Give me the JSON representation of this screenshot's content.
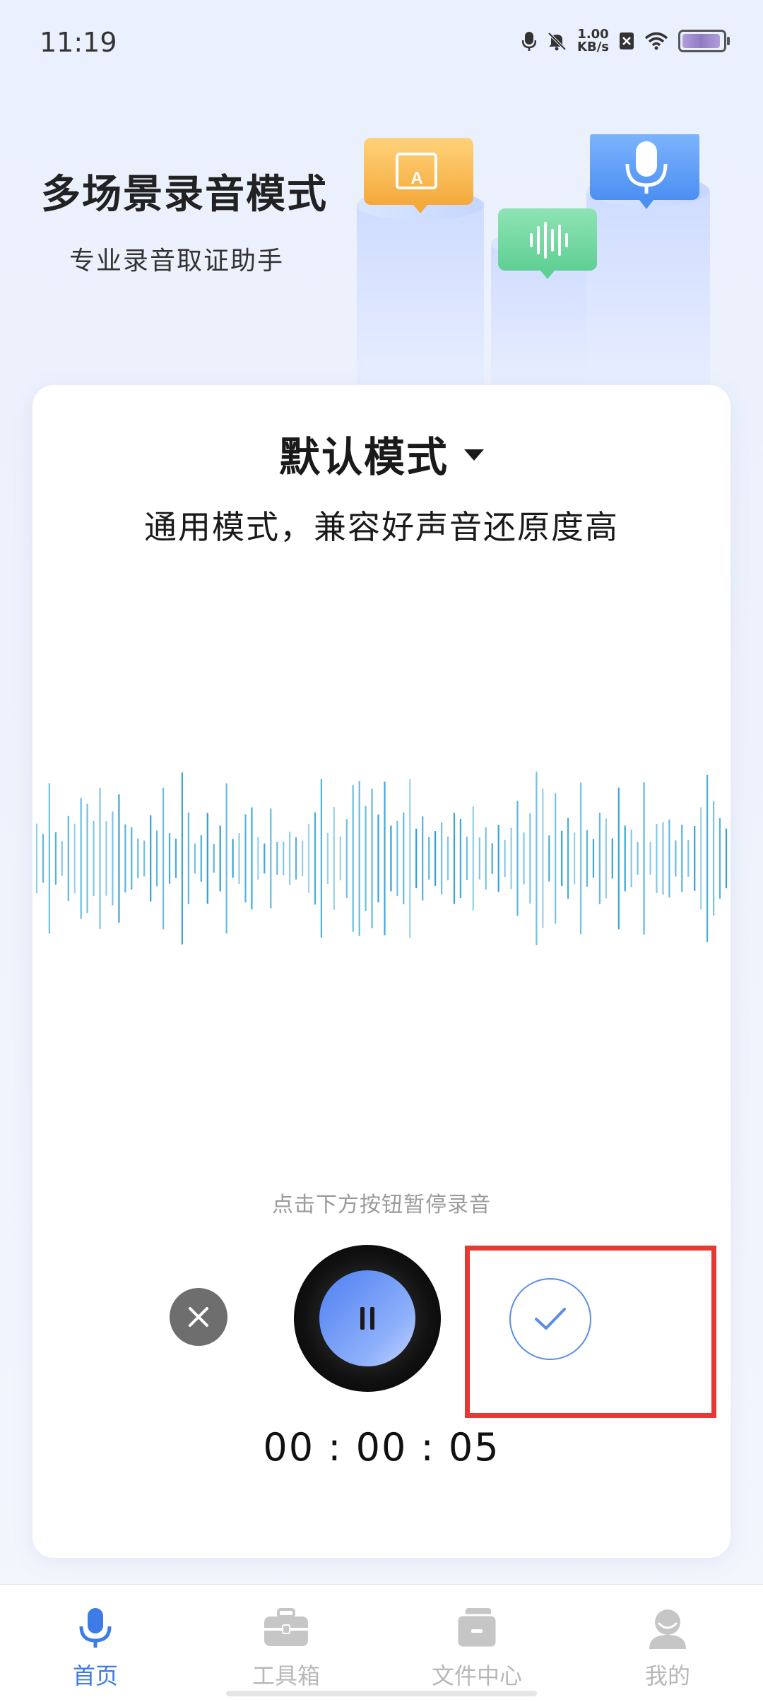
{
  "status_bar": {
    "time": "11:19",
    "net_speed_value": "1.00",
    "net_speed_unit": "KB/s"
  },
  "hero": {
    "title": "多场景录音模式",
    "subtitle": "专业录音取证助手"
  },
  "mode": {
    "title": "默认模式",
    "description": "通用模式，兼容好声音还原度高"
  },
  "recorder": {
    "hint": "点击下方按钮暂停录音",
    "timer": "00 : 00 : 05",
    "state": "recording"
  },
  "colors": {
    "accent": "#3d7be8",
    "wave": "#2a9fd6",
    "highlight": "#e53935"
  },
  "tabs": [
    {
      "label": "首页",
      "icon": "microphone-icon",
      "active": true
    },
    {
      "label": "工具箱",
      "icon": "toolbox-icon",
      "active": false
    },
    {
      "label": "文件中心",
      "icon": "folder-icon",
      "active": false
    },
    {
      "label": "我的",
      "icon": "user-icon",
      "active": false
    }
  ]
}
